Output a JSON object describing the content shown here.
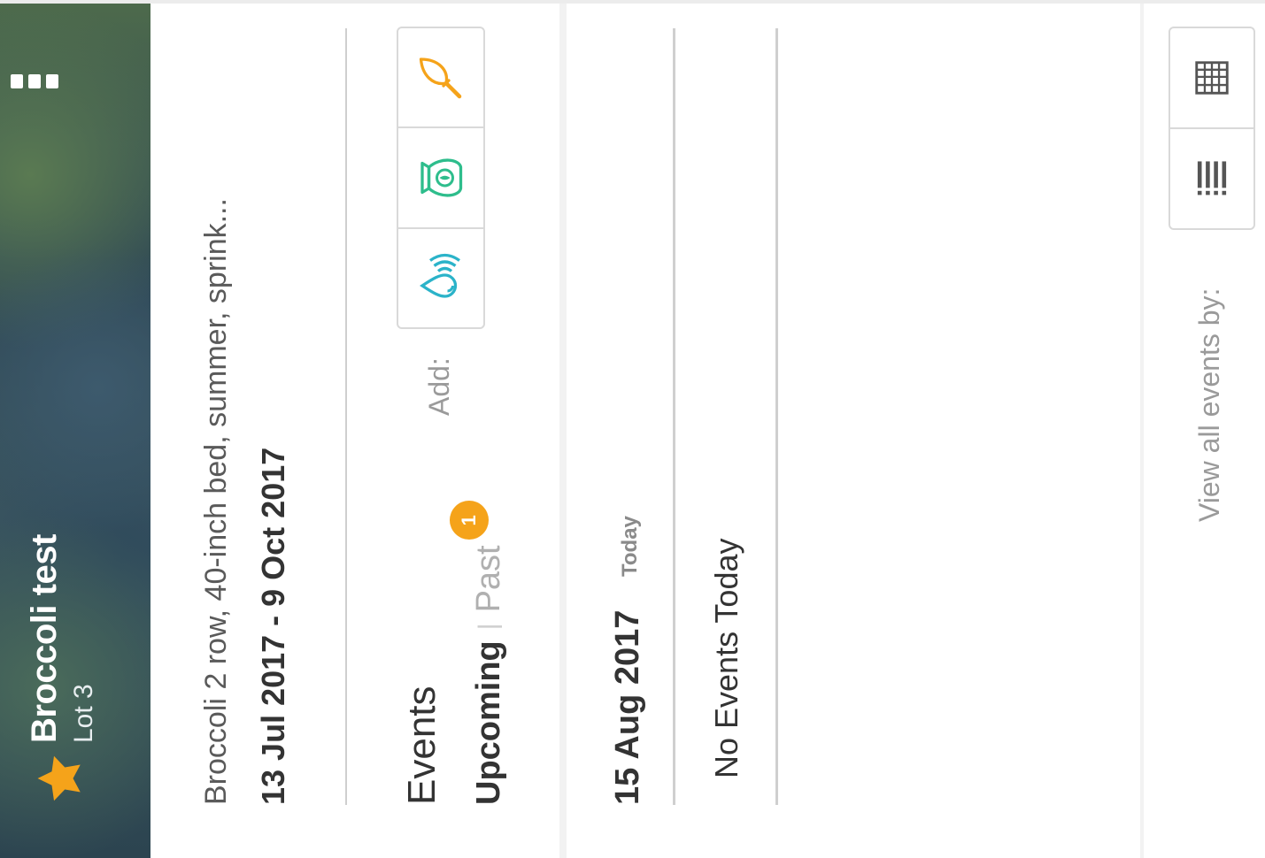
{
  "crop": {
    "title": "Broccoli test",
    "location": "Lot 3",
    "description": "Broccoli 2 row, 40-inch bed, summer, sprink...",
    "date_range": "13 Jul 2017 - 9 Oct 2017"
  },
  "events": {
    "title": "Events",
    "add_label": "Add:",
    "add_buttons": [
      "water-icon",
      "fertilizer-bag-icon",
      "trowel-icon"
    ],
    "tabs": {
      "upcoming": "Upcoming",
      "separator": "|",
      "past": "Past",
      "past_count": "1"
    }
  },
  "day": {
    "date": "15 Aug 2017",
    "today_tag": "Today",
    "empty_message": "No Events Today"
  },
  "view": {
    "label": "View all events by:",
    "buttons": [
      "list-icon",
      "calendar-grid-icon"
    ]
  },
  "colors": {
    "accent_orange": "#f5a31a",
    "water_blue": "#2bb3c9",
    "fertilizer_green": "#2ebd8c"
  }
}
